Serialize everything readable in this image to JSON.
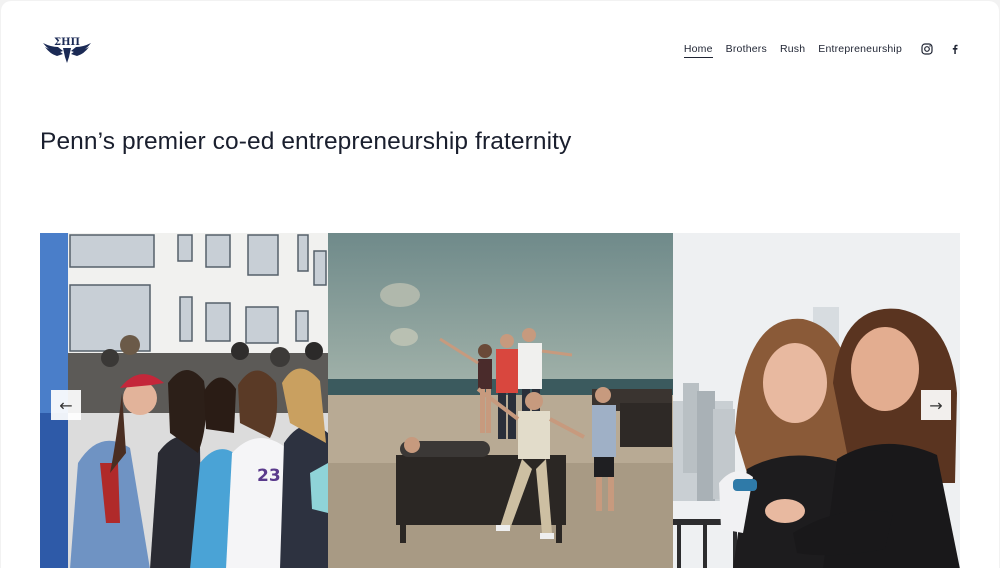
{
  "header": {
    "logo_text": "ΣΗΠ",
    "nav": [
      {
        "label": "Home",
        "active": true
      },
      {
        "label": "Brothers",
        "active": false
      },
      {
        "label": "Rush",
        "active": false
      },
      {
        "label": "Entrepreneurship",
        "active": false
      }
    ],
    "social_icons": [
      "instagram-icon",
      "facebook-icon"
    ]
  },
  "hero": {
    "headline": "Penn’s premier co-ed entrepreneurship fraternity"
  },
  "gallery": {
    "prev_label": "←",
    "next_label": "→",
    "photos": [
      {
        "description": "group of friends posing outdoors in front of a building",
        "jersey_number": "23"
      },
      {
        "description": "friends posing on a beach at dusk"
      },
      {
        "description": "two friends hugging with city skyline behind"
      }
    ]
  },
  "colors": {
    "brand_navy": "#1b2a55",
    "text": "#1a1f2e",
    "background": "#ffffff"
  }
}
